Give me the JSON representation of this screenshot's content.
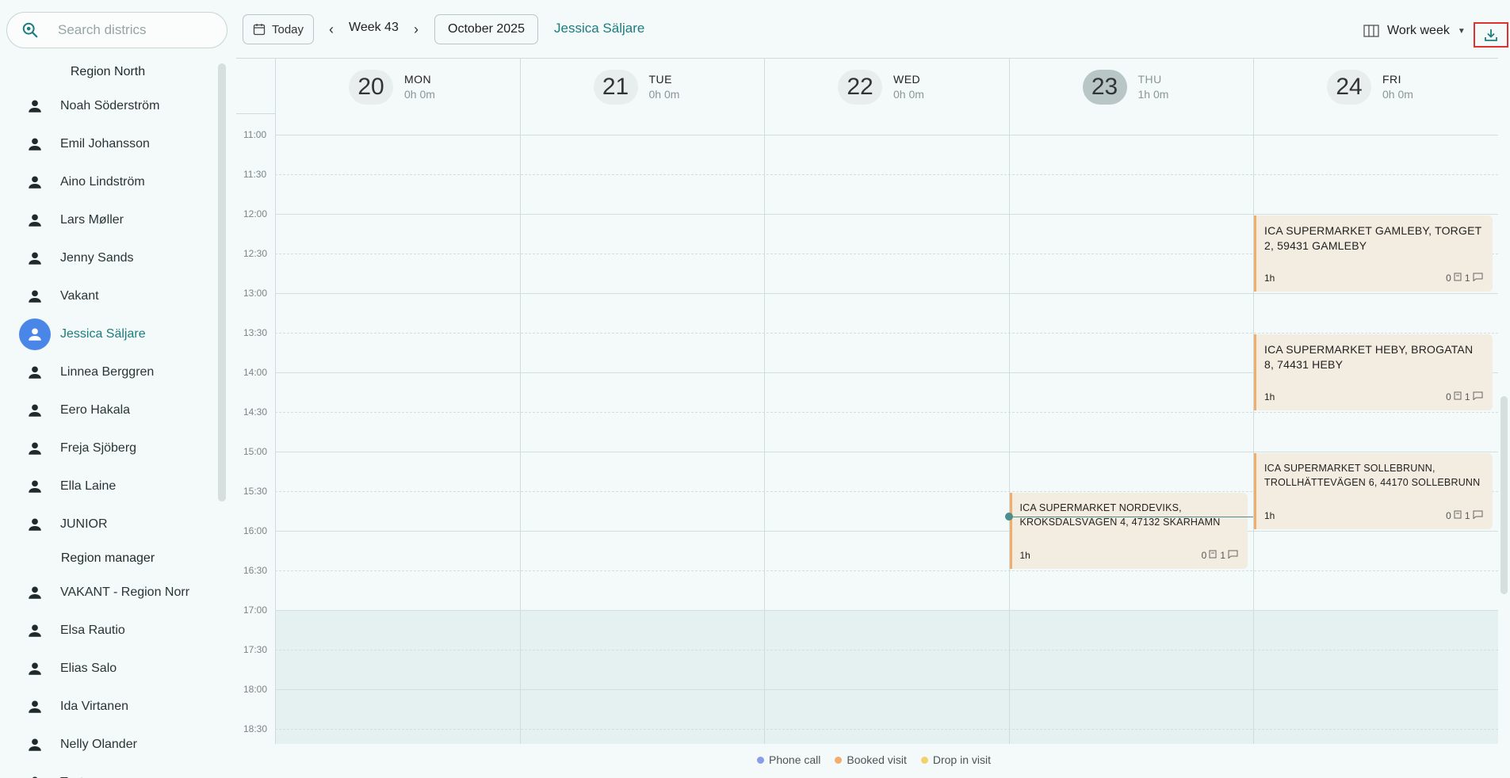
{
  "search": {
    "placeholder": "Search districs",
    "icon": "search-icon"
  },
  "sidebar": {
    "groups": [
      {
        "title": "Region North",
        "people": [
          "Noah Söderström",
          "Emil Johansson",
          "Aino Lindström",
          "Lars Møller",
          "Jenny Sands",
          "Vakant",
          "Jessica Säljare",
          "Linnea Berggren",
          "Eero Hakala",
          "Freja Sjöberg",
          "Ella Laine",
          "JUNIOR"
        ]
      },
      {
        "title": "Region manager",
        "people": [
          "VAKANT - Region Norr",
          "Elsa Rautio",
          "Elias Salo",
          "Ida Virtanen",
          "Nelly Olander",
          "Test"
        ]
      }
    ],
    "active_person": "Jessica Säljare"
  },
  "toolbar": {
    "today_label": "Today",
    "week_label": "Week 43",
    "month_label": "October 2025",
    "selected_person": "Jessica Säljare",
    "view_label": "Work week",
    "download_icon": "download-icon"
  },
  "calendar": {
    "days": [
      {
        "num": "20",
        "name": "MON",
        "hours": "0h 0m",
        "today": false
      },
      {
        "num": "21",
        "name": "TUE",
        "hours": "0h 0m",
        "today": false
      },
      {
        "num": "22",
        "name": "WED",
        "hours": "0h 0m",
        "today": false
      },
      {
        "num": "23",
        "name": "THU",
        "hours": "1h 0m",
        "today": true
      },
      {
        "num": "24",
        "name": "FRI",
        "hours": "0h 0m",
        "today": false
      }
    ],
    "times": [
      "11:00",
      "11:30",
      "12:00",
      "12:30",
      "13:00",
      "13:30",
      "14:00",
      "14:30",
      "15:00",
      "15:30",
      "16:00",
      "16:30",
      "17:00",
      "17:30",
      "18:00",
      "18:30"
    ],
    "events": [
      {
        "day": 4,
        "start": "12:00",
        "end": "13:00",
        "title": "ICA SUPERMARKET GAMLEBY, TORGET 2, 59431 GAMLEBY",
        "duration": "1h",
        "count_a": "0",
        "count_b": "1"
      },
      {
        "day": 4,
        "start": "13:30",
        "end": "14:30",
        "title": "ICA SUPERMARKET HEBY, BROGATAN 8, 74431 HEBY",
        "duration": "1h",
        "count_a": "0",
        "count_b": "1"
      },
      {
        "day": 4,
        "start": "15:00",
        "end": "16:00",
        "title": "ICA SUPERMARKET SOLLEBRUNN, TROLLHÄTTEVÄGEN 6, 44170 SOLLEBRUNN",
        "duration": "1h",
        "count_a": "0",
        "count_b": "1"
      },
      {
        "day": 3,
        "start": "15:30",
        "end": "16:30",
        "title": "ICA SUPERMARKET NORDEVIKS, KROKSDALSVÄGEN 4, 47132 SKÄRHAMN",
        "duration": "1h",
        "count_a": "0",
        "count_b": "1"
      }
    ]
  },
  "legend": [
    {
      "label": "Phone call",
      "color": "#8a9be8"
    },
    {
      "label": "Booked visit",
      "color": "#f0ad6b"
    },
    {
      "label": "Drop in visit",
      "color": "#f2d36b"
    }
  ]
}
